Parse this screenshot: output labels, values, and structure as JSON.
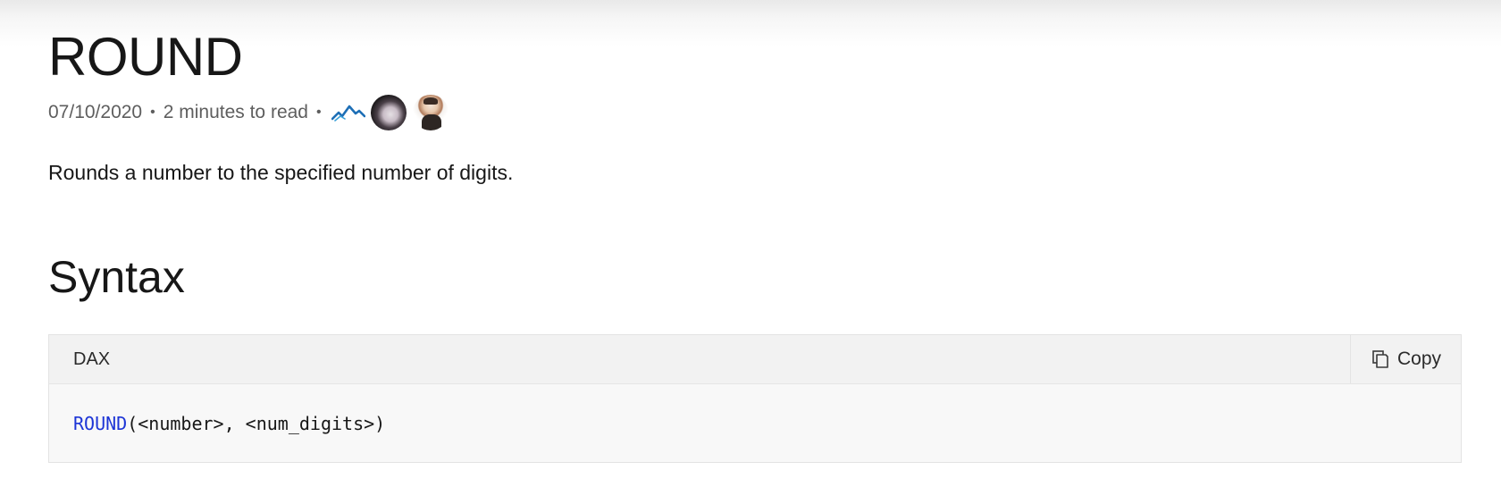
{
  "article": {
    "title": "ROUND",
    "date": "07/10/2020",
    "separator": "•",
    "read_time": "2 minutes to read",
    "description": "Rounds a number to the specified number of digits."
  },
  "contributors": {
    "icons": [
      "mountain-icon",
      "avatar",
      "avatar"
    ]
  },
  "syntax": {
    "heading": "Syntax",
    "code_lang": "DAX",
    "copy_label": "Copy",
    "code_keyword": "ROUND",
    "code_rest": "(<number>, <num_digits>)",
    "keyword_color": "#1d35d6"
  }
}
